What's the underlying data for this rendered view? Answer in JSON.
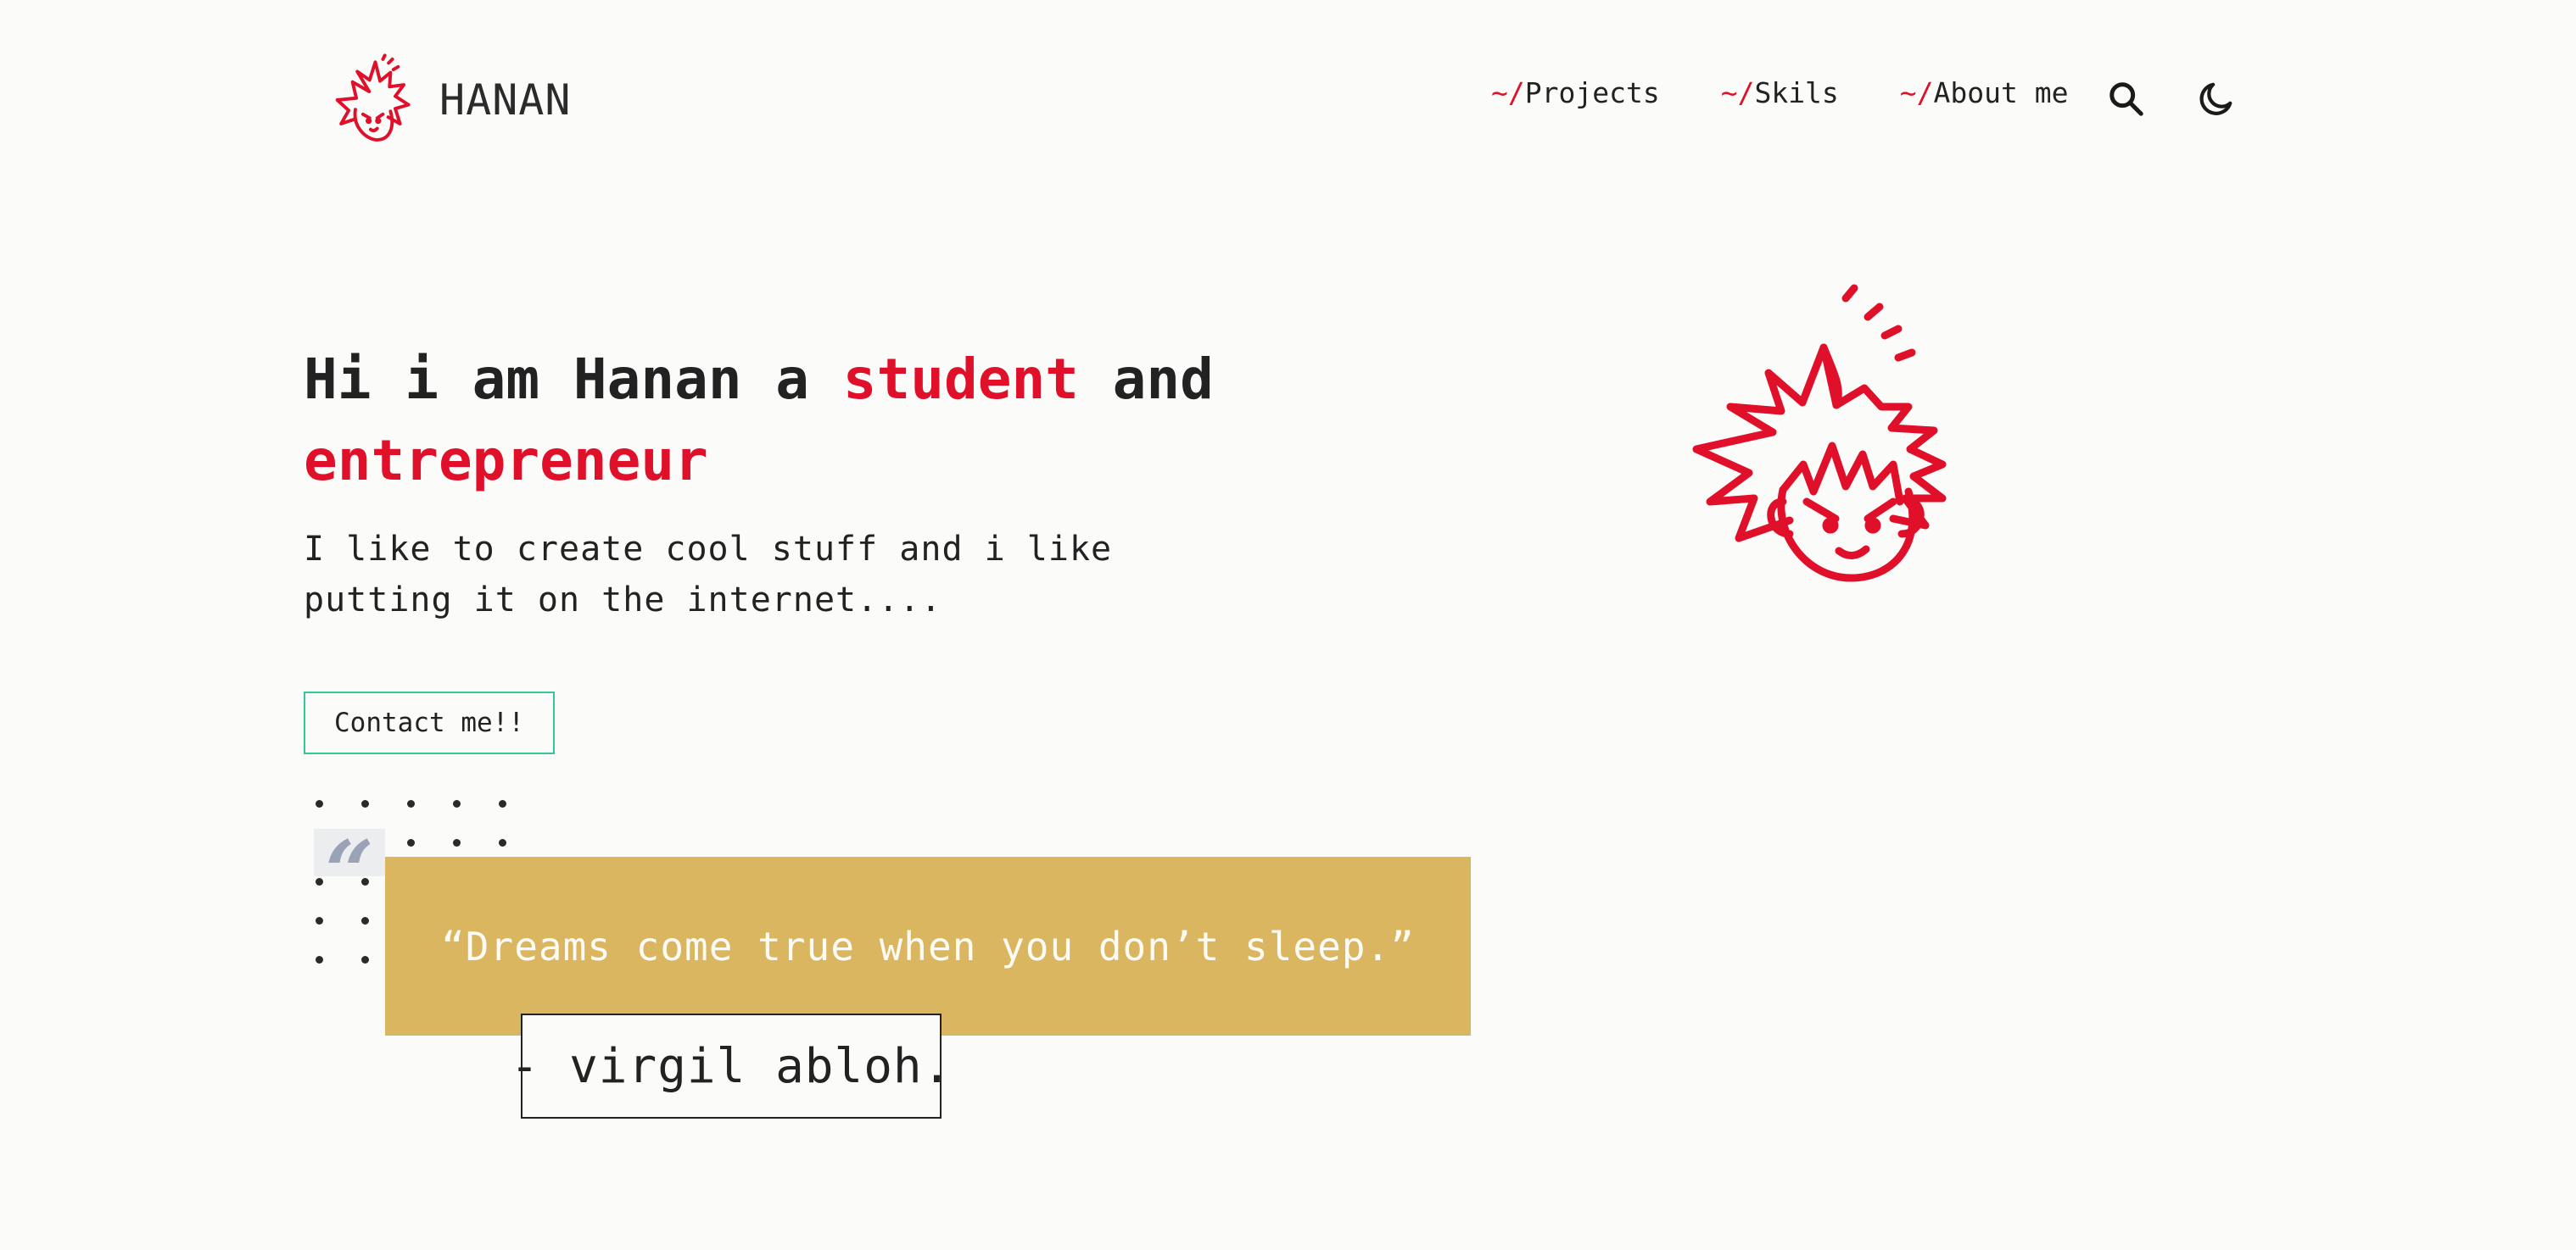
{
  "header": {
    "logo_text": "HANAN",
    "nav": [
      {
        "prefix": "~/",
        "label": "Projects"
      },
      {
        "prefix": "~/",
        "label": "Skils"
      },
      {
        "prefix": "~/",
        "label": "About me"
      }
    ],
    "icons": [
      "search-icon",
      "moon-icon"
    ]
  },
  "hero": {
    "heading_part1": "Hi i am Hanan a ",
    "heading_accent1": "student",
    "heading_part2": " and ",
    "heading_accent2": "entrepreneur",
    "subtitle": "I like to create cool stuff and i like putting it on the internet....",
    "contact_label": "Contact me!!"
  },
  "quote": {
    "mark": "“",
    "text": "“Dreams come true when you don’t sleep.”",
    "author": "- virgil abloh."
  },
  "colors": {
    "accent": "#E0102A",
    "background": "#FBFCF9",
    "button_border": "#35C79A",
    "quote_bg": "#DAB661",
    "quote_mark": "#9AA3B5"
  }
}
